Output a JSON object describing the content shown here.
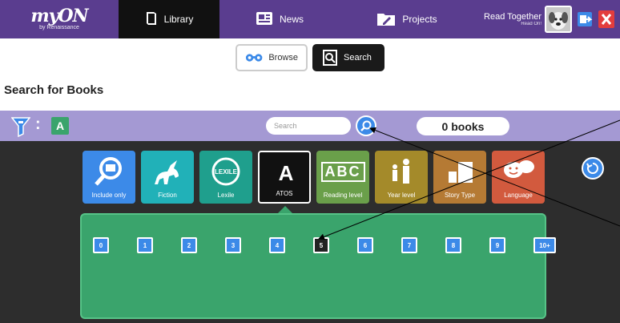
{
  "header": {
    "logo_brand": "myON",
    "logo_sub": "by Renaissance",
    "tabs": [
      {
        "label": "Library",
        "active": true
      },
      {
        "label": "News",
        "active": false
      },
      {
        "label": "Projects",
        "active": false
      }
    ],
    "read_together_title": "Read Together",
    "read_together_sub": "Read On!"
  },
  "subnav": {
    "browse_label": "Browse",
    "search_label": "Search"
  },
  "page_title": "Search for Books",
  "filterbar": {
    "active_filter_chip": "A",
    "search_placeholder": "Search",
    "count_label": "0 books"
  },
  "filters": [
    {
      "label": "Include only",
      "color": "#3c8ae8",
      "icon": "magnifier-badge-icon"
    },
    {
      "label": "Fiction",
      "color": "#21b1b8",
      "icon": "unicorn-icon"
    },
    {
      "label": "Lexile",
      "color": "#1f9f8d",
      "icon": "lexile-icon"
    },
    {
      "label": "ATOS",
      "color": "#111111",
      "icon": "atos-letter-icon",
      "glyph": "A",
      "active": true
    },
    {
      "label": "Reading level",
      "color": "#6a9f4a",
      "icon": "abc-blocks-icon",
      "glyph": "ABC"
    },
    {
      "label": "Year level",
      "color": "#a48a2a",
      "icon": "figures-icon"
    },
    {
      "label": "Story Type",
      "color": "#b57a34",
      "icon": "book-stack-icon"
    },
    {
      "label": "Language",
      "color": "#d25a3e",
      "icon": "speech-bubbles-icon"
    }
  ],
  "levels": [
    {
      "label": "0"
    },
    {
      "label": "1"
    },
    {
      "label": "2"
    },
    {
      "label": "3"
    },
    {
      "label": "4"
    },
    {
      "label": "5",
      "selected": true
    },
    {
      "label": "6"
    },
    {
      "label": "7"
    },
    {
      "label": "8"
    },
    {
      "label": "9"
    },
    {
      "label": "10+"
    }
  ],
  "colors": {
    "topbar": "#5a3d8f",
    "filterbar": "#a499d3",
    "panel": "#2d2d2d",
    "green": "#3aa46c",
    "blue": "#3c8ae8"
  }
}
